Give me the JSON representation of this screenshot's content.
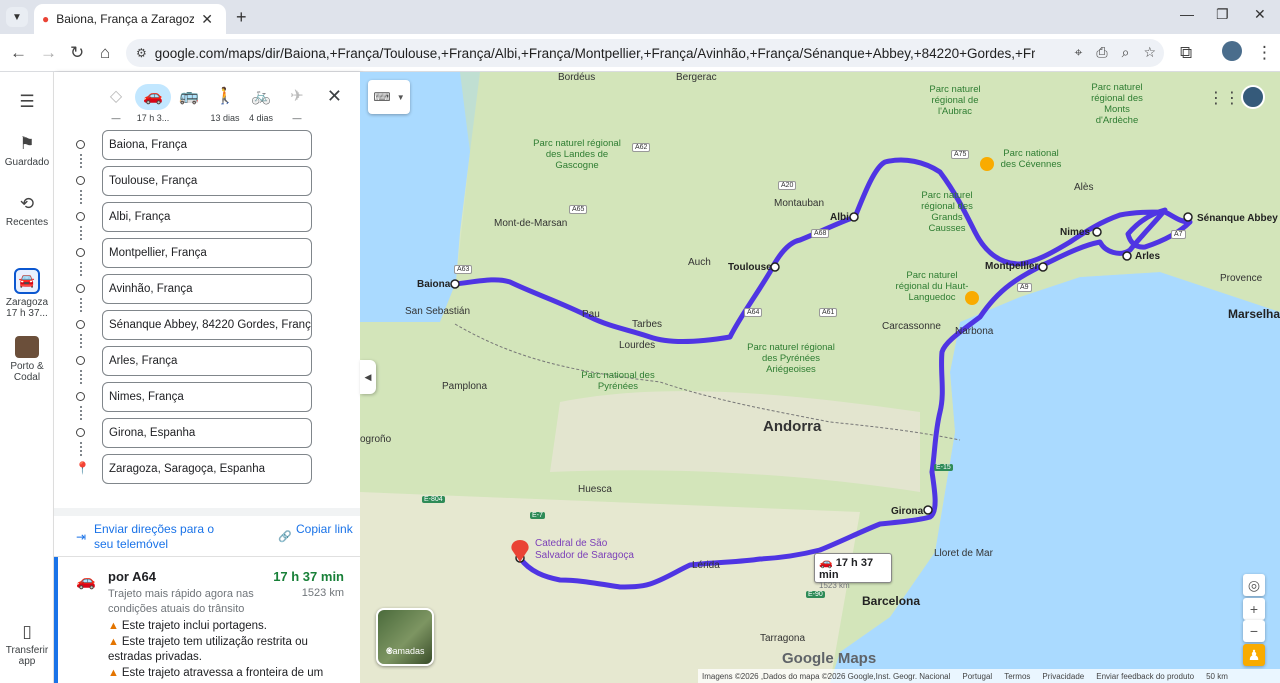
{
  "browser": {
    "tab_title": "Baiona, França a Zaragoza, Saragoça",
    "url": "google.com/maps/dir/Baiona,+França/Toulouse,+França/Albi,+França/Montpellier,+França/Avinhão,+França/Sénanque+Abbey,+84220+Gordes,+França/Arles,+França/Ni..."
  },
  "rail": {
    "saved": "Guardado",
    "recent": "Recentes",
    "trip_label": "Zaragoza",
    "trip_time": "17 h 37...",
    "porto_label": "Porto & Codal",
    "download_label": "Transferir app"
  },
  "modes": [
    {
      "name": "best",
      "label": "—"
    },
    {
      "name": "car",
      "label": "17 h 3..."
    },
    {
      "name": "transit",
      "label": ""
    },
    {
      "name": "walk",
      "label": "13 dias"
    },
    {
      "name": "bike",
      "label": "4 dias"
    },
    {
      "name": "flight",
      "label": "—"
    }
  ],
  "waypoints": [
    "Baiona, França",
    "Toulouse, França",
    "Albi, França",
    "Montpellier, França",
    "Avinhão, França",
    "Sénanque Abbey, 84220 Gordes, França",
    "Arles, França",
    "Nimes, França",
    "Girona, Espanha",
    "Zaragoza, Saragoça, Espanha"
  ],
  "links": {
    "send_to_phone": "Enviar direções para o seu telemóvel",
    "copy_link": "Copiar link"
  },
  "route": {
    "via": "por A64",
    "time": "17 h 37 min",
    "distance": "1523 km",
    "description": "Trajeto mais rápido agora nas condições atuais do trânsito",
    "warnings": [
      "Este trajeto inclui portagens.",
      "Este trajeto tem utilização restrita ou estradas privadas.",
      "Este trajeto atravessa a fronteira de um"
    ]
  },
  "map": {
    "route_box_time": "17 h 37 min",
    "route_box_distance": "1523 km",
    "layers_label": "Camadas",
    "logo": "Google Maps",
    "footer": [
      "Imagens ©2026 ,Dados do mapa ©2026 Google,Inst. Geogr. Nacional",
      "Portugal",
      "Termos",
      "Privacidade",
      "Enviar feedback do produto",
      "50 km"
    ],
    "cities": {
      "baiona": "Baiona",
      "toulouse": "Toulouse",
      "albi": "Albi",
      "montpellier": "Montpellier",
      "nimes": "Nimes",
      "arles": "Arles",
      "senanque": "Sénanque Abbey",
      "girona": "Girona",
      "barcelona": "Barcelona",
      "andorra": "Andorra",
      "marselha": "Marselha",
      "pau": "Pau",
      "bordeus": "Bordéus",
      "montauban": "Montauban",
      "narbona": "Narbona",
      "lerida": "Lérida",
      "huesca": "Huesca",
      "pamplona": "Pamplona",
      "san_sebastian": "San Sebastián",
      "tarragona": "Tarragona",
      "carcassonne": "Carcassonne",
      "tarbes": "Tarbes",
      "lourdes": "Lourdes",
      "auch": "Auch",
      "mont_de_marsan": "Mont-de-Marsan",
      "bergerac": "Bergerac",
      "ales": "Alès",
      "provence": "Provence",
      "lloret": "Lloret de Mar",
      "logrono": "ogroño"
    },
    "parks": {
      "landes": "Parc naturel régional des Landes de Gascogne",
      "pyrenees": "Parc national des Pyrénées",
      "cevennes": "Parc national des Cévennes",
      "grands_causses": "Parc naturel régional des Grands Causses",
      "haut_languedoc": "Parc naturel régional du Haut-Languedoc",
      "pyrenees_ariegeoises": "Parc naturel régional des Pyrénées Ariégeoises",
      "aubrac": "Parc naturel régional de l'Aubrac",
      "ardeche": "Parc naturel régional des Monts d'Ardèche"
    },
    "landmark": "Catedral de São Salvador de Saragoça",
    "roads": [
      "A63",
      "A62",
      "A65",
      "A20",
      "A68",
      "A64",
      "A61",
      "A75",
      "A9",
      "A7",
      "E-15",
      "E-7",
      "E-804",
      "E-90"
    ]
  }
}
